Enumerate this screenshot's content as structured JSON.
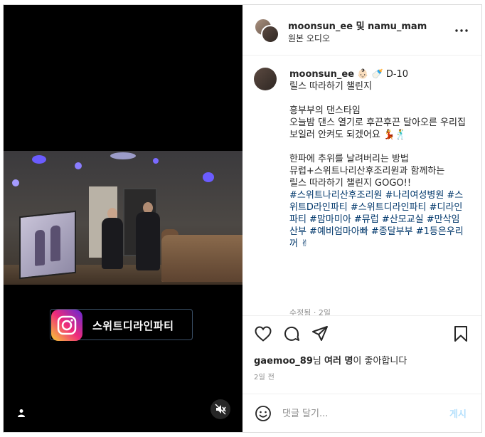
{
  "media": {
    "banner_text": "스위트디라인파티",
    "user_tag_icon": "user-icon",
    "mute_icon": "mute-icon"
  },
  "header": {
    "names": "moonsun_ee 및 namu_mam",
    "subtitle": "원본 오디오",
    "more_icon": "more-icon"
  },
  "caption": {
    "username": "moonsun_ee",
    "first_line_suffix": " 👶🏻 🍼 D-10",
    "lines": "릴스 따라하기 챌린지\n\n흥부부의 댄스타임\n오늘밤 댄스 열기로 후끈후끈 달아오른 우리집\n보일러 안켜도 되겠어요 💃🕺\n\n한파에 추위를 날려버리는 방법\n뮤럽+스위트나리산후조리원과 함께하는\n릴스 따라하기 챌린지 GOGO!!\n",
    "hashtags": "#스위트나리산후조리원 #나리여성병원 #스위트D라인파티 #스위트디라인파티 #디라인파티 #맘마미아 #뮤럽 #산모교실 #만삭임산부 #예비엄마아빠 #종달부부 #1등은우리꺼 ✌",
    "edited": "수정됨 · 2일"
  },
  "actions": {
    "like_icon": "heart-icon",
    "comment_icon": "comment-icon",
    "share_icon": "share-icon",
    "save_icon": "bookmark-icon",
    "liker": "gaemoo_89",
    "likes_mid": "님 ",
    "likes_bold": "여러 명",
    "likes_suffix": "이 좋아합니다",
    "time_ago": "2일 전"
  },
  "comment": {
    "emoji_icon": "smiley-icon",
    "placeholder": "댓글 달기...",
    "post_label": "게시"
  }
}
